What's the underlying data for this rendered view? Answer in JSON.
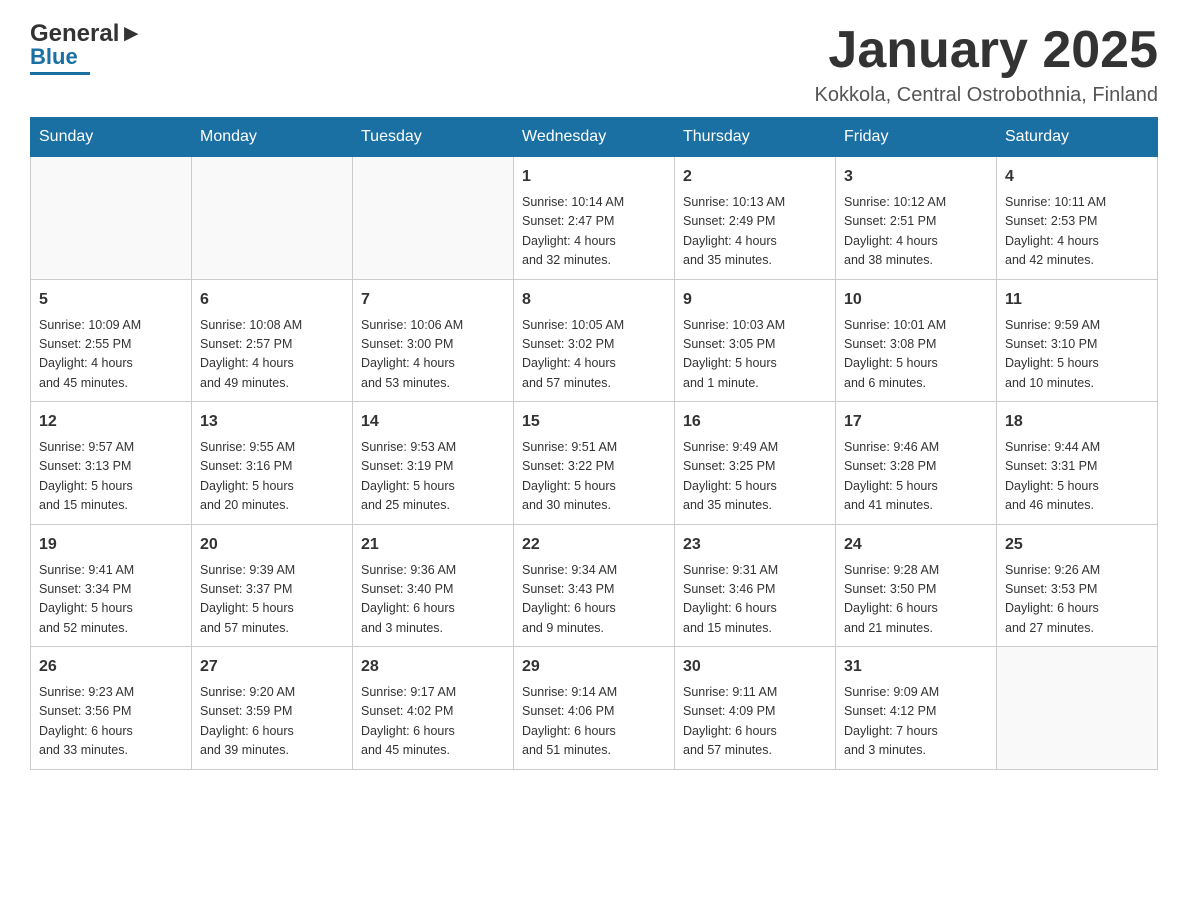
{
  "header": {
    "logo_text1": "General",
    "logo_text2": "Blue",
    "month_title": "January 2025",
    "location": "Kokkola, Central Ostrobothnia, Finland"
  },
  "days_of_week": [
    "Sunday",
    "Monday",
    "Tuesday",
    "Wednesday",
    "Thursday",
    "Friday",
    "Saturday"
  ],
  "weeks": [
    [
      {
        "num": "",
        "info": ""
      },
      {
        "num": "",
        "info": ""
      },
      {
        "num": "",
        "info": ""
      },
      {
        "num": "1",
        "info": "Sunrise: 10:14 AM\nSunset: 2:47 PM\nDaylight: 4 hours\nand 32 minutes."
      },
      {
        "num": "2",
        "info": "Sunrise: 10:13 AM\nSunset: 2:49 PM\nDaylight: 4 hours\nand 35 minutes."
      },
      {
        "num": "3",
        "info": "Sunrise: 10:12 AM\nSunset: 2:51 PM\nDaylight: 4 hours\nand 38 minutes."
      },
      {
        "num": "4",
        "info": "Sunrise: 10:11 AM\nSunset: 2:53 PM\nDaylight: 4 hours\nand 42 minutes."
      }
    ],
    [
      {
        "num": "5",
        "info": "Sunrise: 10:09 AM\nSunset: 2:55 PM\nDaylight: 4 hours\nand 45 minutes."
      },
      {
        "num": "6",
        "info": "Sunrise: 10:08 AM\nSunset: 2:57 PM\nDaylight: 4 hours\nand 49 minutes."
      },
      {
        "num": "7",
        "info": "Sunrise: 10:06 AM\nSunset: 3:00 PM\nDaylight: 4 hours\nand 53 minutes."
      },
      {
        "num": "8",
        "info": "Sunrise: 10:05 AM\nSunset: 3:02 PM\nDaylight: 4 hours\nand 57 minutes."
      },
      {
        "num": "9",
        "info": "Sunrise: 10:03 AM\nSunset: 3:05 PM\nDaylight: 5 hours\nand 1 minute."
      },
      {
        "num": "10",
        "info": "Sunrise: 10:01 AM\nSunset: 3:08 PM\nDaylight: 5 hours\nand 6 minutes."
      },
      {
        "num": "11",
        "info": "Sunrise: 9:59 AM\nSunset: 3:10 PM\nDaylight: 5 hours\nand 10 minutes."
      }
    ],
    [
      {
        "num": "12",
        "info": "Sunrise: 9:57 AM\nSunset: 3:13 PM\nDaylight: 5 hours\nand 15 minutes."
      },
      {
        "num": "13",
        "info": "Sunrise: 9:55 AM\nSunset: 3:16 PM\nDaylight: 5 hours\nand 20 minutes."
      },
      {
        "num": "14",
        "info": "Sunrise: 9:53 AM\nSunset: 3:19 PM\nDaylight: 5 hours\nand 25 minutes."
      },
      {
        "num": "15",
        "info": "Sunrise: 9:51 AM\nSunset: 3:22 PM\nDaylight: 5 hours\nand 30 minutes."
      },
      {
        "num": "16",
        "info": "Sunrise: 9:49 AM\nSunset: 3:25 PM\nDaylight: 5 hours\nand 35 minutes."
      },
      {
        "num": "17",
        "info": "Sunrise: 9:46 AM\nSunset: 3:28 PM\nDaylight: 5 hours\nand 41 minutes."
      },
      {
        "num": "18",
        "info": "Sunrise: 9:44 AM\nSunset: 3:31 PM\nDaylight: 5 hours\nand 46 minutes."
      }
    ],
    [
      {
        "num": "19",
        "info": "Sunrise: 9:41 AM\nSunset: 3:34 PM\nDaylight: 5 hours\nand 52 minutes."
      },
      {
        "num": "20",
        "info": "Sunrise: 9:39 AM\nSunset: 3:37 PM\nDaylight: 5 hours\nand 57 minutes."
      },
      {
        "num": "21",
        "info": "Sunrise: 9:36 AM\nSunset: 3:40 PM\nDaylight: 6 hours\nand 3 minutes."
      },
      {
        "num": "22",
        "info": "Sunrise: 9:34 AM\nSunset: 3:43 PM\nDaylight: 6 hours\nand 9 minutes."
      },
      {
        "num": "23",
        "info": "Sunrise: 9:31 AM\nSunset: 3:46 PM\nDaylight: 6 hours\nand 15 minutes."
      },
      {
        "num": "24",
        "info": "Sunrise: 9:28 AM\nSunset: 3:50 PM\nDaylight: 6 hours\nand 21 minutes."
      },
      {
        "num": "25",
        "info": "Sunrise: 9:26 AM\nSunset: 3:53 PM\nDaylight: 6 hours\nand 27 minutes."
      }
    ],
    [
      {
        "num": "26",
        "info": "Sunrise: 9:23 AM\nSunset: 3:56 PM\nDaylight: 6 hours\nand 33 minutes."
      },
      {
        "num": "27",
        "info": "Sunrise: 9:20 AM\nSunset: 3:59 PM\nDaylight: 6 hours\nand 39 minutes."
      },
      {
        "num": "28",
        "info": "Sunrise: 9:17 AM\nSunset: 4:02 PM\nDaylight: 6 hours\nand 45 minutes."
      },
      {
        "num": "29",
        "info": "Sunrise: 9:14 AM\nSunset: 4:06 PM\nDaylight: 6 hours\nand 51 minutes."
      },
      {
        "num": "30",
        "info": "Sunrise: 9:11 AM\nSunset: 4:09 PM\nDaylight: 6 hours\nand 57 minutes."
      },
      {
        "num": "31",
        "info": "Sunrise: 9:09 AM\nSunset: 4:12 PM\nDaylight: 7 hours\nand 3 minutes."
      },
      {
        "num": "",
        "info": ""
      }
    ]
  ]
}
